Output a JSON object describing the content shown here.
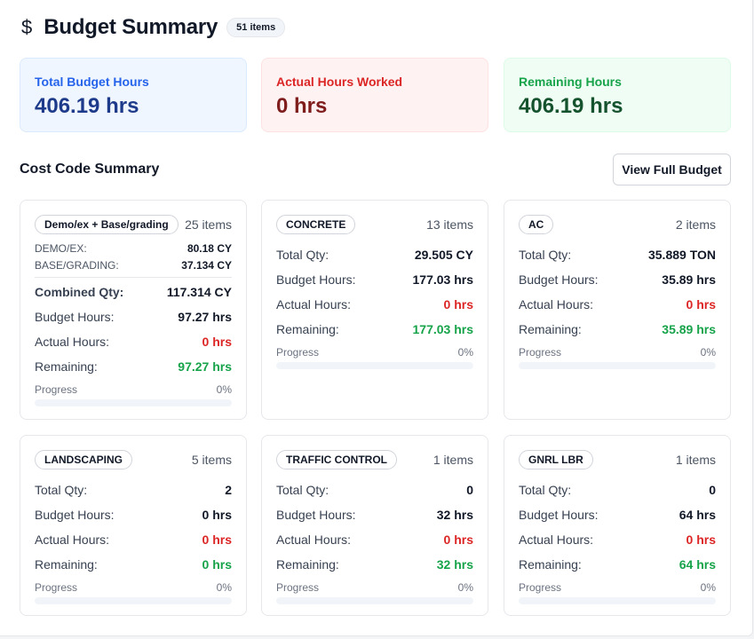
{
  "header": {
    "title": "Budget Summary",
    "badge": "51 items"
  },
  "stats": {
    "total": {
      "label": "Total Budget Hours",
      "value": "406.19 hrs"
    },
    "actual": {
      "label": "Actual Hours Worked",
      "value": "0 hrs"
    },
    "remaining": {
      "label": "Remaining Hours",
      "value": "406.19 hrs"
    }
  },
  "section": {
    "title": "Cost Code Summary",
    "button": "View Full Budget"
  },
  "labels": {
    "combined": "Combined Qty:",
    "total_qty": "Total Qty:",
    "budget": "Budget Hours:",
    "actual": "Actual Hours:",
    "remaining": "Remaining:",
    "progress": "Progress"
  },
  "cards": [
    {
      "name": "Demo/ex + Base/grading",
      "count": "25 items",
      "subs": [
        {
          "label": "DEMO/EX:",
          "value": "80.18 CY"
        },
        {
          "label": "BASE/GRADING:",
          "value": "37.134 CY"
        }
      ],
      "qty": "117.314 CY",
      "budget": "97.27 hrs",
      "actual": "0 hrs",
      "remaining": "97.27 hrs",
      "progress_label": "0%",
      "progress": 0
    },
    {
      "name": "CONCRETE",
      "count": "13 items",
      "qty": "29.505 CY",
      "budget": "177.03 hrs",
      "actual": "0 hrs",
      "remaining": "177.03 hrs",
      "progress_label": "0%",
      "progress": 0
    },
    {
      "name": "AC",
      "count": "2 items",
      "qty": "35.889 TON",
      "budget": "35.89 hrs",
      "actual": "0 hrs",
      "remaining": "35.89 hrs",
      "progress_label": "0%",
      "progress": 0
    },
    {
      "name": "LANDSCAPING",
      "count": "5 items",
      "qty": "2",
      "budget": "0 hrs",
      "actual": "0 hrs",
      "remaining": "0 hrs",
      "progress_label": "0%",
      "progress": 0
    },
    {
      "name": "TRAFFIC CONTROL",
      "count": "1 items",
      "qty": "0",
      "budget": "32 hrs",
      "actual": "0 hrs",
      "remaining": "32 hrs",
      "progress_label": "0%",
      "progress": 0
    },
    {
      "name": "GNRL LBR",
      "count": "1 items",
      "qty": "0",
      "budget": "64 hrs",
      "actual": "0 hrs",
      "remaining": "64 hrs",
      "progress_label": "0%",
      "progress": 0
    }
  ],
  "colors": {
    "accent": "#2563eb",
    "danger": "#dc2626",
    "success": "#16a34a"
  },
  "icons": {
    "header": "dollar-icon"
  }
}
